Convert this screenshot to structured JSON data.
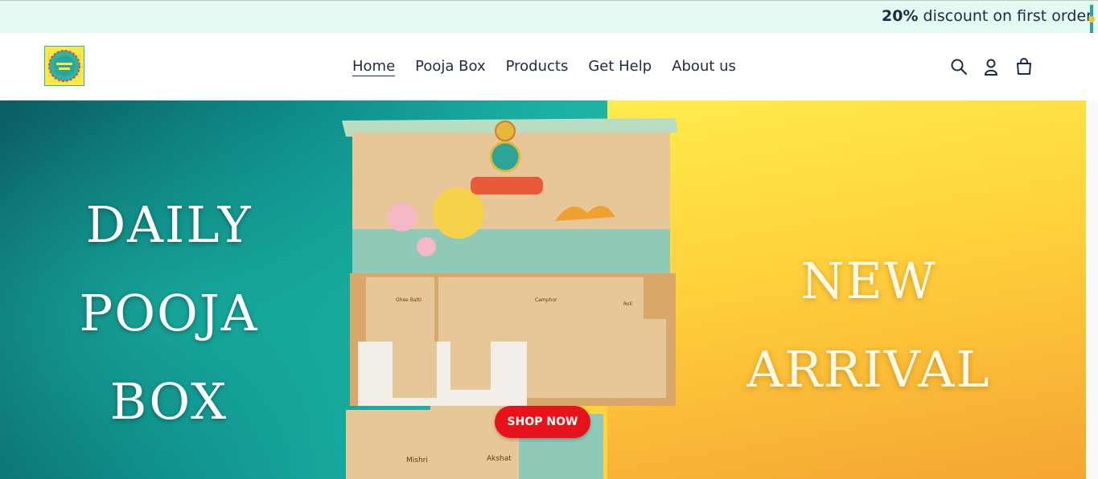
{
  "announcement": {
    "bold": "20%",
    "text": " discount on first order c"
  },
  "nav": {
    "items": [
      {
        "label": "Home",
        "active": true
      },
      {
        "label": "Pooja Box"
      },
      {
        "label": "Products"
      },
      {
        "label": "Get Help"
      },
      {
        "label": "About us"
      }
    ]
  },
  "header_icons": [
    "search-icon",
    "account-icon",
    "cart-icon"
  ],
  "hero": {
    "left_lines": [
      "DAILY",
      "POOJA",
      "BOX"
    ],
    "right_lines": [
      "NEW",
      "ARRIVAL"
    ],
    "cta": "SHOP NOW",
    "box_items": [
      "Ghee Batti",
      "Camphor",
      "Roli",
      "Mishri",
      "Akshat"
    ]
  },
  "colors": {
    "teal": "#1bb0a4",
    "yellow": "#ffd13a",
    "cta": "#e8131a",
    "announce_bg": "#e3f9f2"
  }
}
